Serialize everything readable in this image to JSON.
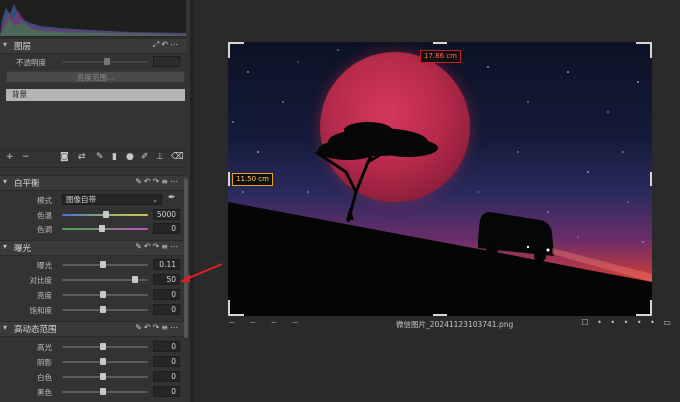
{
  "layers": {
    "title": "图层",
    "opacity_label": "不透明度",
    "range_button": "亮度范围...",
    "background_layer": "背景"
  },
  "white_balance": {
    "title": "白平衡",
    "mode_label": "模式",
    "mode_value": "图像自带",
    "temp_label": "色温",
    "temp_value": "5000",
    "tint_label": "色调",
    "tint_value": "0"
  },
  "exposure": {
    "title": "曝光",
    "rows": [
      {
        "label": "曝光",
        "value": "0.11",
        "level": 0.47
      },
      {
        "label": "对比度",
        "value": "50",
        "level": 0.88
      },
      {
        "label": "亮度",
        "value": "0",
        "level": 0.47
      },
      {
        "label": "饱和度",
        "value": "0",
        "level": 0.47
      }
    ]
  },
  "hdr": {
    "title": "高动态范围",
    "rows": [
      {
        "label": "高光",
        "value": "0",
        "level": 0.47
      },
      {
        "label": "阴影",
        "value": "0",
        "level": 0.47
      },
      {
        "label": "白色",
        "value": "0",
        "level": 0.47
      },
      {
        "label": "黑色",
        "value": "0",
        "level": 0.47
      }
    ]
  },
  "canvas": {
    "measure_width": "17.86 cm",
    "measure_height": "11.50 cm"
  },
  "footer": {
    "filename": "微信图片_20241123103741.png"
  },
  "icons": {
    "section_tools": [
      "pipette-icon",
      "undo-icon",
      "redo-icon",
      "menu-icon",
      "more-icon"
    ],
    "layer_toolbar": [
      "add-icon",
      "remove-icon",
      "mask-icon",
      "link-icon",
      "brush-icon",
      "gradient-icon",
      "radial-icon",
      "erase-icon",
      "fill-icon",
      "eraser-icon"
    ]
  },
  "colors": {
    "accent_orange": "#e8a31a",
    "accent_red": "#c02020",
    "panel_bg": "#333333"
  }
}
